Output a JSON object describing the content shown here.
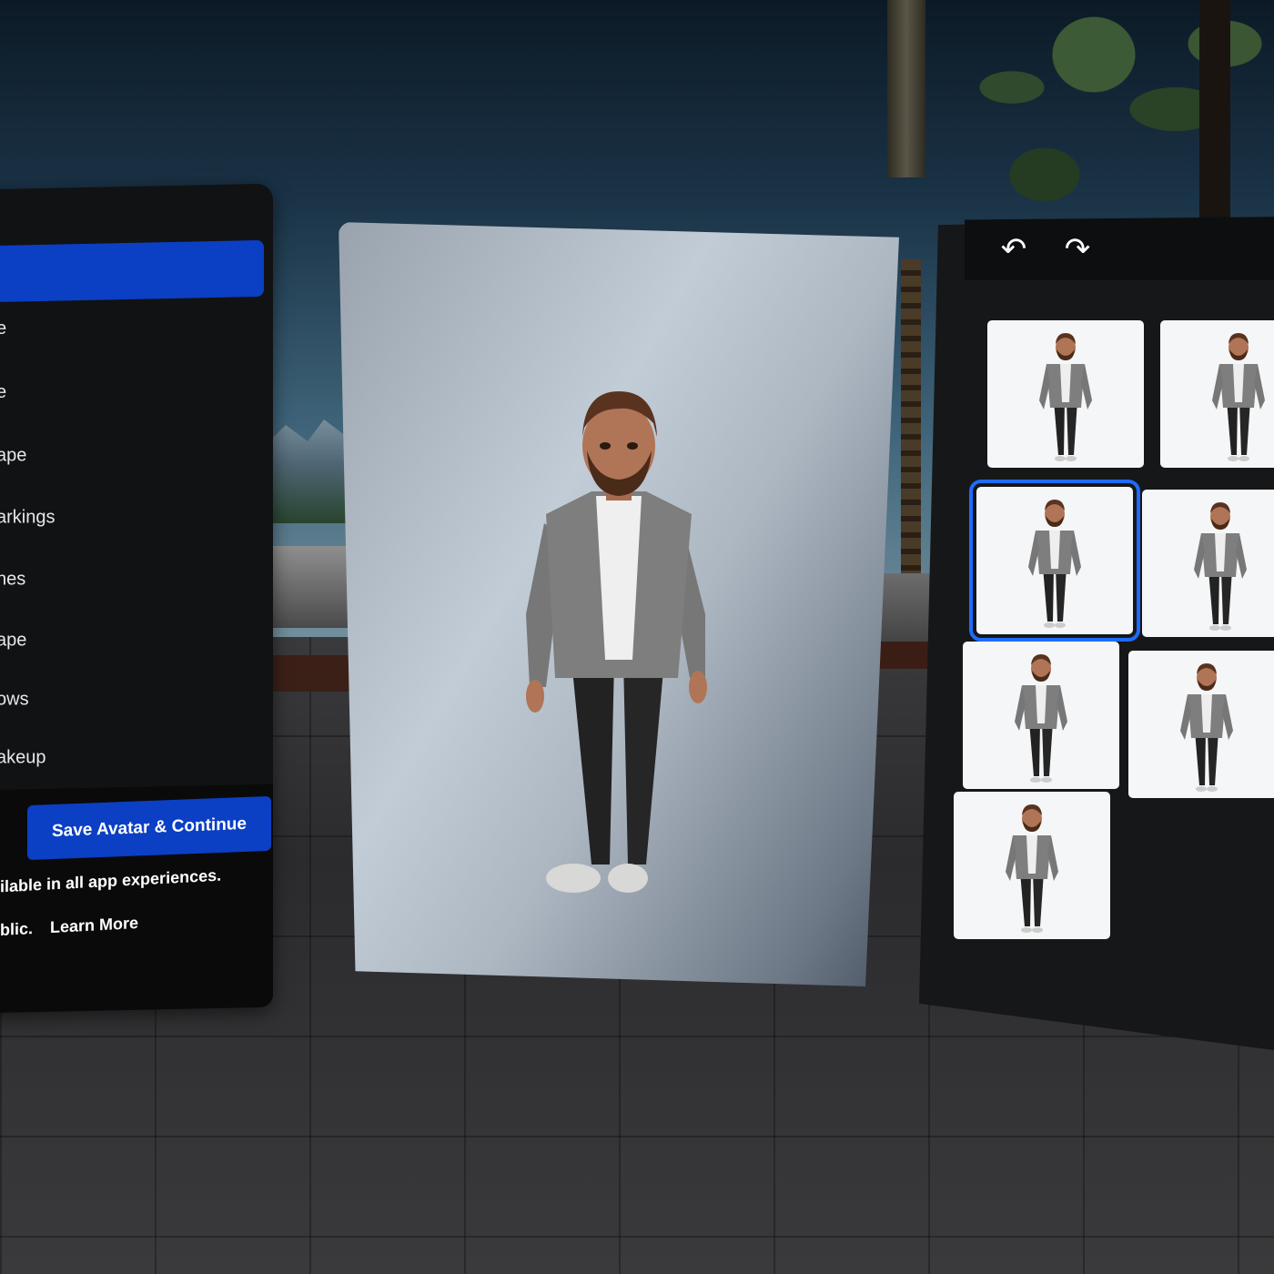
{
  "left_panel": {
    "menu_items": [
      {
        "label": "",
        "selected": true
      },
      {
        "label": "e"
      },
      {
        "label": "e"
      },
      {
        "label": "ape"
      },
      {
        "label": "arkings"
      },
      {
        "label": "nes"
      },
      {
        "label": "ape"
      },
      {
        "label": "ows"
      },
      {
        "label": "akeup"
      }
    ],
    "save_button": "Save Avatar & Continue",
    "note_line1": "ilable in all app experiences.",
    "note_line2": "blic.",
    "learn_more": "Learn More"
  },
  "right_panel": {
    "undo_icon": "undo-icon",
    "redo_icon": "redo-icon",
    "options_count": 7,
    "selected_index": 2
  },
  "colors": {
    "accent": "#0b3fc4",
    "selection_outline": "#1f6bff",
    "panel_bg": "#111214"
  }
}
